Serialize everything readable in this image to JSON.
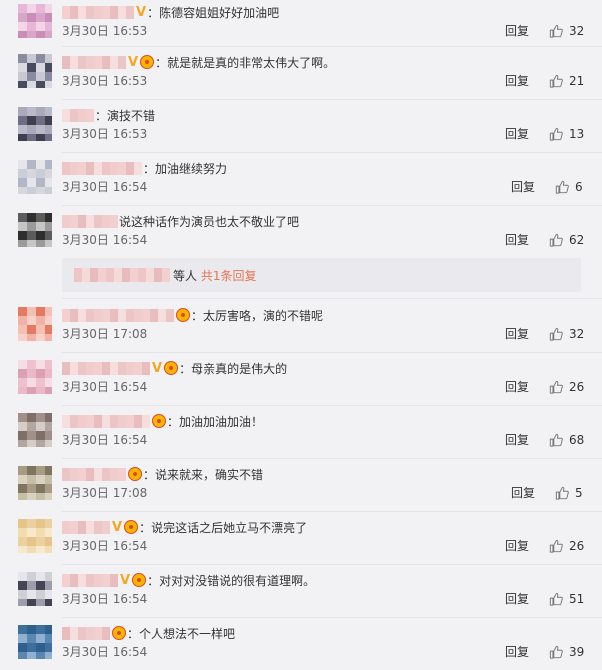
{
  "comments": [
    {
      "text": "：陈德容姐姐好好加油吧",
      "time": "3月30日 16:53",
      "reply": "回复",
      "likes": "32",
      "badges": [
        "v"
      ],
      "colors": [
        "#e8b6d6",
        "#c98db8",
        "#f2d5e6",
        "#d7a7c9"
      ]
    },
    {
      "text": "：就是就是真的非常太伟大了啊。",
      "time": "3月30日 16:53",
      "reply": "回复",
      "likes": "21",
      "badges": [
        "v",
        "c"
      ],
      "colors": [
        "#d9d9df",
        "#8a8aa0",
        "#4b4b60",
        "#c9c9d3"
      ]
    },
    {
      "text": "：演技不错",
      "time": "3月30日 16:53",
      "reply": "回复",
      "likes": "13",
      "badges": [],
      "colors": [
        "#b9b9c9",
        "#6d6d85",
        "#a9a9b7",
        "#3f3f50"
      ]
    },
    {
      "text": "：加油继续努力",
      "time": "3月30日 16:54",
      "reply": "回复",
      "likes": "6",
      "badges": [],
      "colors": [
        "#d6d6dc",
        "#b0b8c8",
        "#c9cfd9",
        "#e6e6ea"
      ]
    },
    {
      "text": "说这种话作为演员也太不敬业了吧",
      "time": "3月30日 16:54",
      "reply": "回复",
      "likes": "62",
      "badges": [],
      "colors": [
        "#5c5c5c",
        "#9b9b9b",
        "#2f2f2f",
        "#c6c6c6"
      ]
    },
    {
      "text": "：太厉害咯，演的不错呢",
      "time": "3月30日 17:08",
      "reply": "回复",
      "likes": "32",
      "badges": [
        "c"
      ],
      "colors": [
        "#f2b3a6",
        "#e47a63",
        "#f8d2c8",
        "#f5c0b4"
      ]
    },
    {
      "text": "：母亲真的是伟大的",
      "time": "3月30日 16:54",
      "reply": "回复",
      "likes": "26",
      "badges": [
        "v",
        "c"
      ],
      "colors": [
        "#efc1cf",
        "#dba0b4",
        "#f5dde5",
        "#e9b9c8"
      ]
    },
    {
      "text": "：加油加油加油！",
      "time": "3月30日 16:54",
      "reply": "回复",
      "likes": "68",
      "badges": [
        "c"
      ],
      "colors": [
        "#b2a6a0",
        "#7e6f68",
        "#d6cdc8",
        "#a19089"
      ]
    },
    {
      "text": "：说来就来，确实不错",
      "time": "3月30日 17:08",
      "reply": "回复",
      "likes": "5",
      "badges": [
        "c"
      ],
      "colors": [
        "#a79b84",
        "#c7bea6",
        "#80755f",
        "#d9d2c0"
      ]
    },
    {
      "text": "：说完这话之后她立马不漂亮了",
      "time": "3月30日 16:54",
      "reply": "回复",
      "likes": "26",
      "badges": [
        "v",
        "c"
      ],
      "colors": [
        "#f3dcae",
        "#e7c489",
        "#f7e9cc",
        "#ebd19f"
      ]
    },
    {
      "text": "：对对对没错说的很有道理啊。",
      "time": "3月30日 16:54",
      "reply": "回复",
      "likes": "51",
      "badges": [
        "v",
        "c"
      ],
      "colors": [
        "#cfcfd6",
        "#444455",
        "#e5e5ea",
        "#9d9dab"
      ]
    },
    {
      "text": "：个人想法不一样吧",
      "time": "3月30日 16:54",
      "reply": "回复",
      "likes": "39",
      "badges": [
        "c"
      ],
      "colors": [
        "#5a86b2",
        "#2f5f8c",
        "#8fb0cf",
        "#3d6e9c"
      ]
    }
  ],
  "sub_reply": {
    "others": "等人",
    "link": "共1条回复"
  },
  "colors": {
    "accent": "#eb7350",
    "vip": "#f5a623",
    "background": "#f2f2f5",
    "name_blur": "#f0c7c7"
  },
  "icons": {
    "like": "thumbs-up-icon"
  }
}
